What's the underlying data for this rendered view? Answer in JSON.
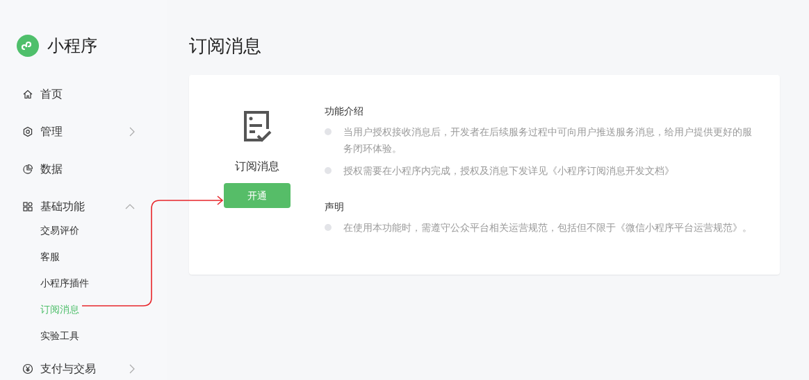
{
  "sidebar": {
    "brand": "小程序",
    "items": [
      {
        "label": "首页",
        "kind": "link"
      },
      {
        "label": "管理",
        "kind": "group",
        "expanded": false
      },
      {
        "label": "数据",
        "kind": "link"
      },
      {
        "label": "基础功能",
        "kind": "group",
        "expanded": true,
        "children": [
          {
            "label": "交易评价",
            "selected": false
          },
          {
            "label": "客服",
            "selected": false
          },
          {
            "label": "小程序插件",
            "selected": false
          },
          {
            "label": "订阅消息",
            "selected": true
          },
          {
            "label": "实验工具",
            "selected": false
          }
        ]
      },
      {
        "label": "支付与交易",
        "kind": "group",
        "expanded": false
      }
    ]
  },
  "page": {
    "title": "订阅消息"
  },
  "card": {
    "feature_name": "订阅消息",
    "button": "开通",
    "sections": [
      {
        "heading": "功能介绍",
        "bullets": [
          "当用户授权接收消息后，开发者在后续服务过程中可向用户推送服务消息，给用户提供更好的服务闭环体验。",
          "授权需要在小程序内完成，授权及消息下发详见《小程序订阅消息开发文档》"
        ]
      },
      {
        "heading": "声明",
        "bullets": [
          "在使用本功能时，需遵守公众平台相关运营规范，包括但不限于《微信小程序平台运营规范》。"
        ]
      }
    ]
  }
}
